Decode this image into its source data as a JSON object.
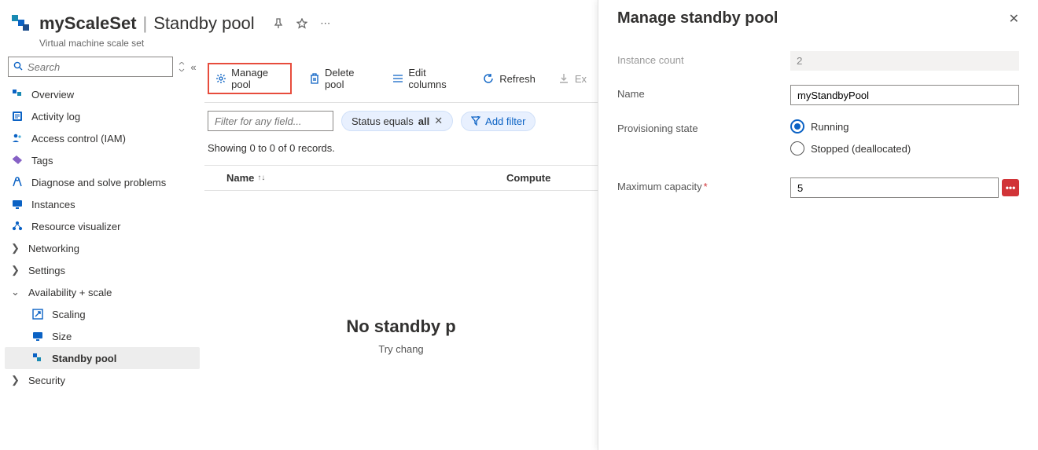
{
  "header": {
    "resource_name": "myScaleSet",
    "section": "Standby pool",
    "subtype": "Virtual machine scale set"
  },
  "search": {
    "placeholder": "Search"
  },
  "sidebar": {
    "items": [
      {
        "label": "Overview",
        "icon": "overview"
      },
      {
        "label": "Activity log",
        "icon": "activity"
      },
      {
        "label": "Access control (IAM)",
        "icon": "access"
      },
      {
        "label": "Tags",
        "icon": "tags"
      },
      {
        "label": "Diagnose and solve problems",
        "icon": "diagnose"
      },
      {
        "label": "Instances",
        "icon": "instances"
      },
      {
        "label": "Resource visualizer",
        "icon": "visualizer"
      }
    ],
    "groups": [
      {
        "label": "Networking",
        "expanded": false
      },
      {
        "label": "Settings",
        "expanded": false
      },
      {
        "label": "Availability + scale",
        "expanded": true,
        "children": [
          {
            "label": "Scaling",
            "icon": "scaling"
          },
          {
            "label": "Size",
            "icon": "size"
          },
          {
            "label": "Standby pool",
            "icon": "standby",
            "active": true
          }
        ]
      },
      {
        "label": "Security",
        "expanded": false
      }
    ]
  },
  "toolbar": {
    "manage": "Manage pool",
    "delete": "Delete pool",
    "edit": "Edit columns",
    "refresh": "Refresh",
    "export": "Ex"
  },
  "filter": {
    "placeholder": "Filter for any field...",
    "status_pill_prefix": "Status equals ",
    "status_pill_value": "all",
    "add_filter": "Add filter"
  },
  "table": {
    "showing": "Showing 0 to 0 of 0 records.",
    "col_name": "Name",
    "col_compute": "Compute"
  },
  "empty": {
    "title": "No standby p",
    "sub": "Try chang"
  },
  "panel": {
    "title": "Manage standby pool",
    "instance_count_lbl": "Instance count",
    "instance_count_val": "2",
    "name_lbl": "Name",
    "name_val": "myStandbyPool",
    "prov_lbl": "Provisioning state",
    "radio_running": "Running",
    "radio_stopped": "Stopped (deallocated)",
    "max_cap_lbl": "Maximum capacity",
    "max_cap_val": "5",
    "err_badge": "•••"
  }
}
